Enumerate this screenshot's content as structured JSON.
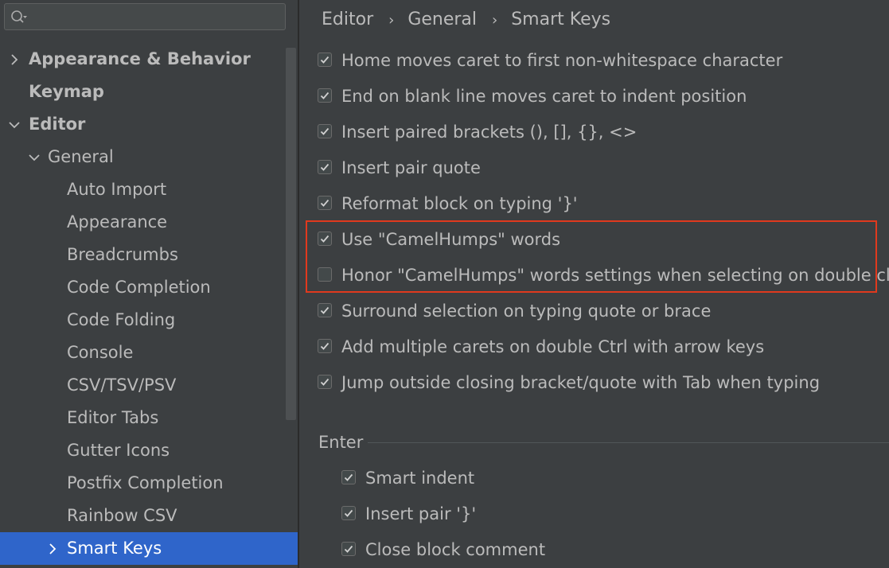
{
  "search": {
    "placeholder": ""
  },
  "sidebar": {
    "items": [
      {
        "label": "Appearance & Behavior",
        "chevron": "right",
        "bold": true
      },
      {
        "label": "Keymap",
        "chevron": "",
        "bold": true
      },
      {
        "label": "Editor",
        "chevron": "down",
        "bold": true
      },
      {
        "label": "General",
        "chevron": "down",
        "bold": false
      },
      {
        "label": "Auto Import"
      },
      {
        "label": "Appearance"
      },
      {
        "label": "Breadcrumbs"
      },
      {
        "label": "Code Completion"
      },
      {
        "label": "Code Folding"
      },
      {
        "label": "Console"
      },
      {
        "label": "CSV/TSV/PSV"
      },
      {
        "label": "Editor Tabs"
      },
      {
        "label": "Gutter Icons"
      },
      {
        "label": "Postfix Completion"
      },
      {
        "label": "Rainbow CSV"
      },
      {
        "label": "Smart Keys",
        "chevron": "right",
        "selected": true
      }
    ]
  },
  "breadcrumb": [
    "Editor",
    "General",
    "Smart Keys"
  ],
  "options": [
    {
      "label": "Home moves caret to first non-whitespace character",
      "checked": true
    },
    {
      "label": "End on blank line moves caret to indent position",
      "checked": true
    },
    {
      "label": "Insert paired brackets (), [], {}, <>",
      "checked": true
    },
    {
      "label": "Insert pair quote",
      "checked": true
    },
    {
      "label": "Reformat block on typing '}'",
      "checked": true
    },
    {
      "label": "Use \"CamelHumps\" words",
      "checked": true
    },
    {
      "label": "Honor \"CamelHumps\" words settings when selecting on double click",
      "checked": false
    },
    {
      "label": "Surround selection on typing quote or brace",
      "checked": true
    },
    {
      "label": "Add multiple carets on double Ctrl with arrow keys",
      "checked": true
    },
    {
      "label": "Jump outside closing bracket/quote with Tab when typing",
      "checked": true
    }
  ],
  "enter": {
    "title": "Enter",
    "options": [
      {
        "label": "Smart indent",
        "checked": true
      },
      {
        "label": "Insert pair '}'",
        "checked": true
      },
      {
        "label": "Close block comment",
        "checked": true
      }
    ]
  },
  "colors": {
    "selection": "#2f65ca",
    "highlight_border": "#e0391d"
  }
}
